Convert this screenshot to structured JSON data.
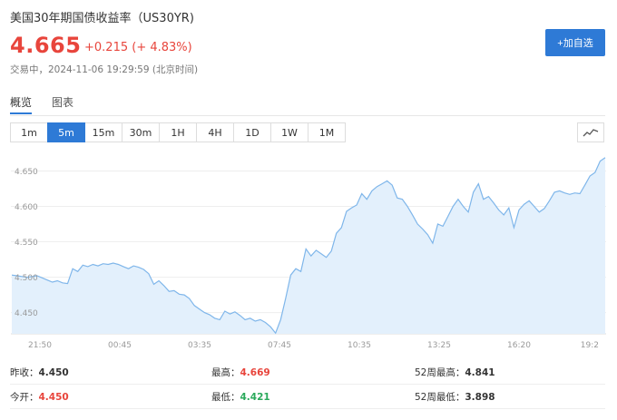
{
  "header": {
    "title": "美国30年期国债收益率（US30YR)",
    "price": "4.665",
    "change": "+0.215 (+ 4.83%)",
    "status": "交易中，",
    "time": "2024-11-06 19:29:59 (北京时间)",
    "add_label": "+加自选"
  },
  "tabs": [
    {
      "label": "概览",
      "active": true
    },
    {
      "label": "图表",
      "active": false
    }
  ],
  "periods": [
    {
      "label": "1m"
    },
    {
      "label": "5m"
    },
    {
      "label": "15m"
    },
    {
      "label": "30m"
    },
    {
      "label": "1H"
    },
    {
      "label": "4H"
    },
    {
      "label": "1D"
    },
    {
      "label": "1W"
    },
    {
      "label": "1M"
    }
  ],
  "active_period": "5m",
  "colors": {
    "up": "#e8453c",
    "down": "#2aa95b",
    "accent": "#2e7ad6",
    "line": "#7fb6ea",
    "area": "#e3f0fc"
  },
  "stats": {
    "prev_close_label": "昨收：",
    "prev_close": "4.450",
    "high_label": "最高：",
    "high": "4.669",
    "high52_label": "52周最高：",
    "high52": "4.841",
    "open_label": "今开：",
    "open": "4.450",
    "low_label": "最低：",
    "low": "4.421",
    "low52_label": "52周最低：",
    "low52": "3.898"
  },
  "chart_data": {
    "type": "area",
    "x_ticks": [
      "21:50",
      "00:45",
      "03:35",
      "07:45",
      "10:35",
      "13:25",
      "16:20",
      "19:2"
    ],
    "y_ticks": [
      "4.450",
      "4.500",
      "4.550",
      "4.600",
      "4.650"
    ],
    "y_tick_values": [
      4.45,
      4.5,
      4.55,
      4.6,
      4.65
    ],
    "ylim": [
      4.42,
      4.675
    ],
    "grid": true,
    "values": [
      4.503,
      4.502,
      4.501,
      4.5,
      4.501,
      4.502,
      4.499,
      4.496,
      4.493,
      4.495,
      4.492,
      4.491,
      4.512,
      4.508,
      4.517,
      4.515,
      4.518,
      4.516,
      4.519,
      4.518,
      4.52,
      4.518,
      4.515,
      4.512,
      4.516,
      4.514,
      4.511,
      4.505,
      4.49,
      4.495,
      4.488,
      4.48,
      4.481,
      4.476,
      4.475,
      4.47,
      4.46,
      4.455,
      4.45,
      4.447,
      4.442,
      4.44,
      4.452,
      4.448,
      4.451,
      4.446,
      4.44,
      4.442,
      4.438,
      4.44,
      4.436,
      4.43,
      4.421,
      4.44,
      4.47,
      4.503,
      4.512,
      4.508,
      4.54,
      4.53,
      4.538,
      4.533,
      4.528,
      4.537,
      4.562,
      4.57,
      4.593,
      4.598,
      4.602,
      4.618,
      4.61,
      4.622,
      4.628,
      4.632,
      4.636,
      4.63,
      4.612,
      4.61,
      4.6,
      4.588,
      4.575,
      4.568,
      4.56,
      4.548,
      4.575,
      4.572,
      4.586,
      4.6,
      4.61,
      4.6,
      4.592,
      4.62,
      4.632,
      4.61,
      4.614,
      4.605,
      4.595,
      4.588,
      4.598,
      4.57,
      4.595,
      4.603,
      4.608,
      4.6,
      4.592,
      4.597,
      4.608,
      4.62,
      4.622,
      4.619,
      4.617,
      4.619,
      4.618,
      4.63,
      4.643,
      4.648,
      4.664,
      4.669
    ]
  }
}
